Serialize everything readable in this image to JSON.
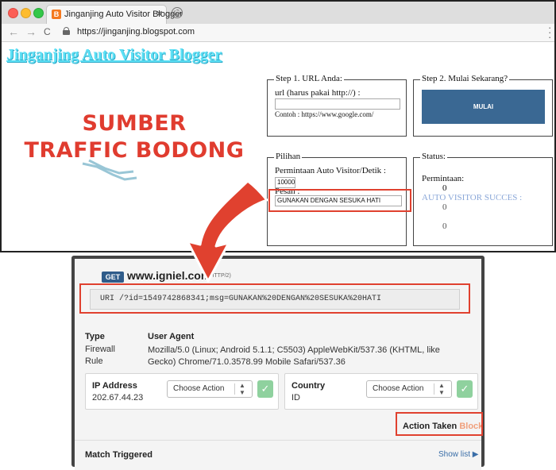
{
  "browser": {
    "tab_title": "Jinganjing Auto Visitor Blogger",
    "tab_close": "✕",
    "favicon_letter": "B",
    "url": "https://jinganjing.blogspot.com",
    "back": "←",
    "forward": "→",
    "reload": "C"
  },
  "blog": {
    "title": "Jinganjing Auto Visitor Blogger"
  },
  "promo": {
    "line1": "SUMBER",
    "line2": "TRAFFIC BODONG"
  },
  "step1": {
    "legend": "Step 1. URL Anda:",
    "label": "url (harus pakai http://) :",
    "url_value": "",
    "example": "Contoh : https://www.google.com/"
  },
  "step2": {
    "legend": "Step 2. Mulai Sekarang?",
    "button": "MULAI"
  },
  "pilihan": {
    "legend": "Pilihan",
    "label": "Permintaan Auto Visitor/Detik :",
    "rate_value": "10000",
    "pesan_label": "Pesan :",
    "pesan_value": "GUNAKAN DENGAN SESUKA HATI"
  },
  "status": {
    "legend": "Status:",
    "permintaan_label": "Permintaan:",
    "permintaan_value": "0",
    "success_label": "AUTO VISITOR SUCCES :",
    "success_value": "0",
    "third_value": "0"
  },
  "firewall": {
    "method": "GET",
    "host": "www.igniel.com",
    "protocol": "(HTTP/2)",
    "uri": "URI /?id=1549742868341;msg=GUNAKAN%20DENGAN%20SESUKA%20HATI",
    "type_label": "Type",
    "firewall_label": "Firewall",
    "rule_label": "Rule",
    "ua_header": "User Agent",
    "user_agent": "Mozilla/5.0 (Linux; Android 5.1.1; C5503) AppleWebKit/537.36 (KHTML, like Gecko) Chrome/71.0.3578.99 Mobile Safari/537.36",
    "ip_label": "IP Address",
    "ip_value": "202.67.44.23",
    "country_label": "Country",
    "country_value": "ID",
    "choose_action": "Choose Action",
    "check": "✓",
    "action_taken_label": "Action Taken",
    "action_taken_value": "Block",
    "match_triggered": "Match Triggered",
    "show_list": "Show list ▶"
  },
  "colors": {
    "accent_red": "#e0412f",
    "blog_title": "#5ce0f5",
    "button_blue": "#3a6893",
    "block_orange": "#f0a07c"
  }
}
